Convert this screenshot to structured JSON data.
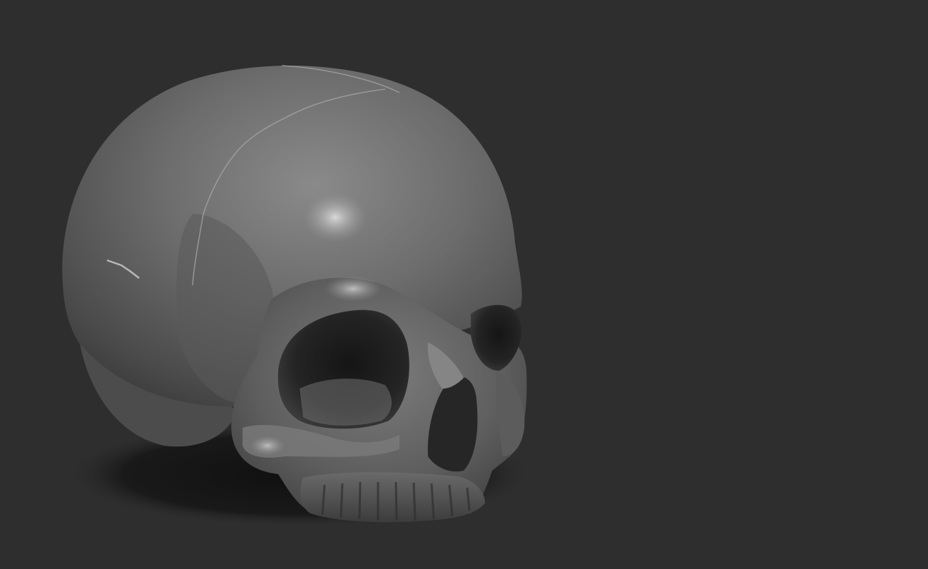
{
  "viewport": {
    "background_color": "#2e2e2e",
    "subject": "skull-sculpt"
  },
  "material": {
    "base_color": "#6e6e6e",
    "highlight_color": "#d6d6d6",
    "shadow_color": "#141414"
  }
}
